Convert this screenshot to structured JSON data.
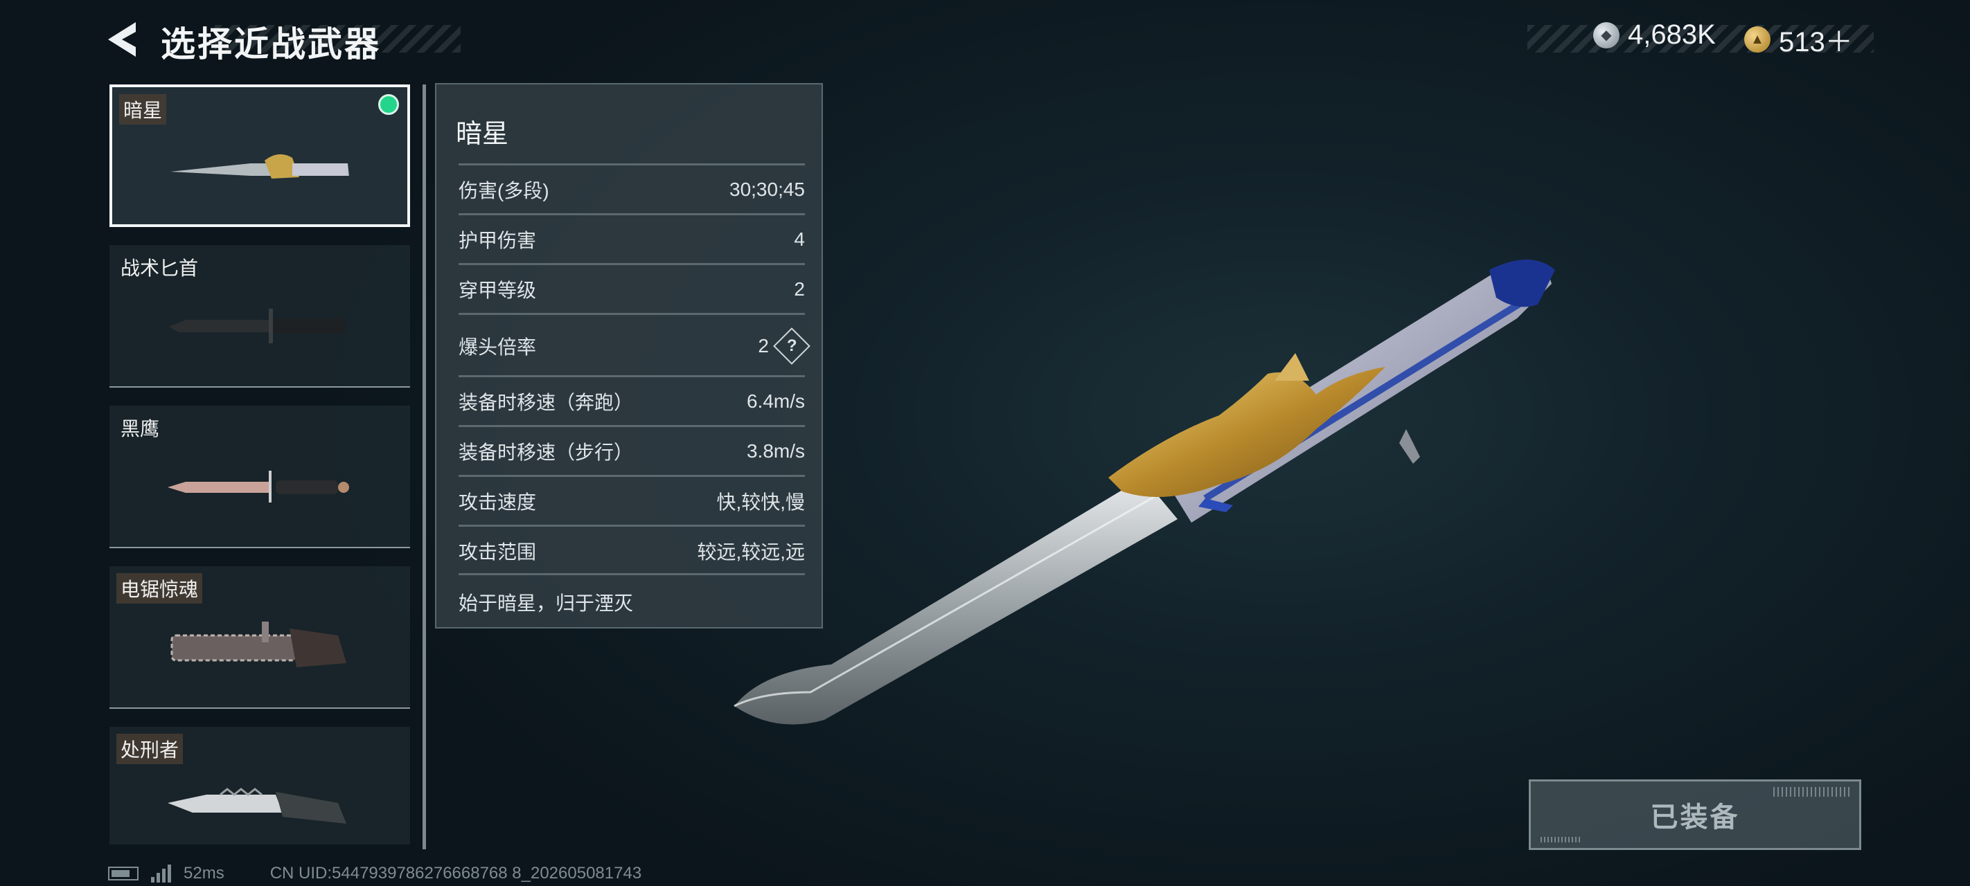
{
  "header": {
    "title": "选择近战武器",
    "back_icon": "back-arrow-icon"
  },
  "currency": [
    {
      "icon": "silver-coin-icon",
      "value": "4,683K"
    },
    {
      "icon": "gold-coin-icon",
      "value": "513＋"
    }
  ],
  "weapon_list": [
    {
      "name": "暗星",
      "selected": true,
      "equipped": true
    },
    {
      "name": "战术匕首",
      "selected": false,
      "equipped": false
    },
    {
      "name": "黑鹰",
      "selected": false,
      "equipped": false
    },
    {
      "name": "电锯惊魂",
      "selected": false,
      "equipped": false
    },
    {
      "name": "处刑者",
      "selected": false,
      "equipped": false
    }
  ],
  "details": {
    "name": "暗星",
    "stats": [
      {
        "label": "伤害(多段)",
        "value": "30;30;45"
      },
      {
        "label": "护甲伤害",
        "value": "4"
      },
      {
        "label": "穿甲等级",
        "value": "2"
      },
      {
        "label": "爆头倍率",
        "value": "2",
        "help": "?"
      },
      {
        "label": "装备时移速（奔跑）",
        "value": "6.4m/s"
      },
      {
        "label": "装备时移速（步行）",
        "value": "3.8m/s"
      },
      {
        "label": "攻击速度",
        "value": "快,较快,慢"
      },
      {
        "label": "攻击范围",
        "value": "较远,较远,远"
      }
    ],
    "motto": "始于暗星，归于湮灭"
  },
  "equip_button": {
    "label": "已装备"
  },
  "footer": {
    "ping": "52ms",
    "uid": "CN UID:5447939786276668768 8_202605081743"
  },
  "colors": {
    "background": "#0f1c22",
    "equipped_indicator": "#22d58a",
    "panel": "#343f45"
  }
}
